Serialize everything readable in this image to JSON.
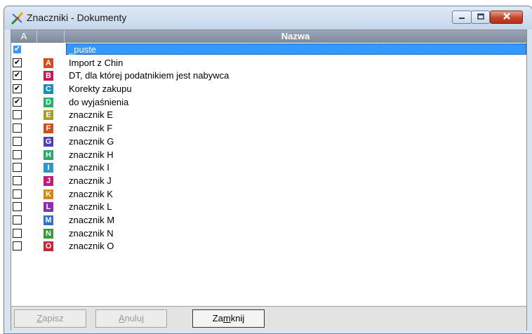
{
  "window": {
    "title": "Znaczniki - Dokumenty"
  },
  "table": {
    "headers": {
      "checked": "A",
      "name": "Nazwa"
    },
    "rows": [
      {
        "checked": true,
        "letter": "",
        "color": "",
        "label": "_puste",
        "selected": true
      },
      {
        "checked": true,
        "letter": "A",
        "color": "#d94a1a",
        "label": "Import z Chin"
      },
      {
        "checked": true,
        "letter": "B",
        "color": "#c21d58",
        "label": "DT, dla której podatnikiem jest nabywca"
      },
      {
        "checked": true,
        "letter": "C",
        "color": "#1c8fb8",
        "label": "Korekty zakupu"
      },
      {
        "checked": true,
        "letter": "D",
        "color": "#28b06a",
        "label": "do wyjaśnienia"
      },
      {
        "checked": false,
        "letter": "E",
        "color": "#a7a11d",
        "label": "znacznik E"
      },
      {
        "checked": false,
        "letter": "F",
        "color": "#d14e22",
        "label": "znacznik F"
      },
      {
        "checked": false,
        "letter": "G",
        "color": "#4f3fb5",
        "label": "znacznik G"
      },
      {
        "checked": false,
        "letter": "H",
        "color": "#28a86a",
        "label": "znacznik H"
      },
      {
        "checked": false,
        "letter": "I",
        "color": "#2d97c9",
        "label": "znacznik I"
      },
      {
        "checked": false,
        "letter": "J",
        "color": "#c4197a",
        "label": "znacznik J"
      },
      {
        "checked": false,
        "letter": "K",
        "color": "#d48a12",
        "label": "znacznik K"
      },
      {
        "checked": false,
        "letter": "L",
        "color": "#8a2fb0",
        "label": "znacznik L"
      },
      {
        "checked": false,
        "letter": "M",
        "color": "#2f72c7",
        "label": "znacznik M"
      },
      {
        "checked": false,
        "letter": "N",
        "color": "#3a9a3a",
        "label": "znacznik N"
      },
      {
        "checked": false,
        "letter": "O",
        "color": "#c42a3a",
        "label": "znacznik O"
      }
    ]
  },
  "buttons": {
    "save": {
      "label": "Zapisz",
      "enabled": false
    },
    "cancel": {
      "label": "Anuluj",
      "enabled": false
    },
    "close": {
      "label": "Zamknij",
      "enabled": true
    }
  },
  "icons": {
    "app": "marker-pen-icon",
    "minimize": "minimize-icon",
    "maximize": "maximize-icon",
    "close": "close-icon"
  }
}
